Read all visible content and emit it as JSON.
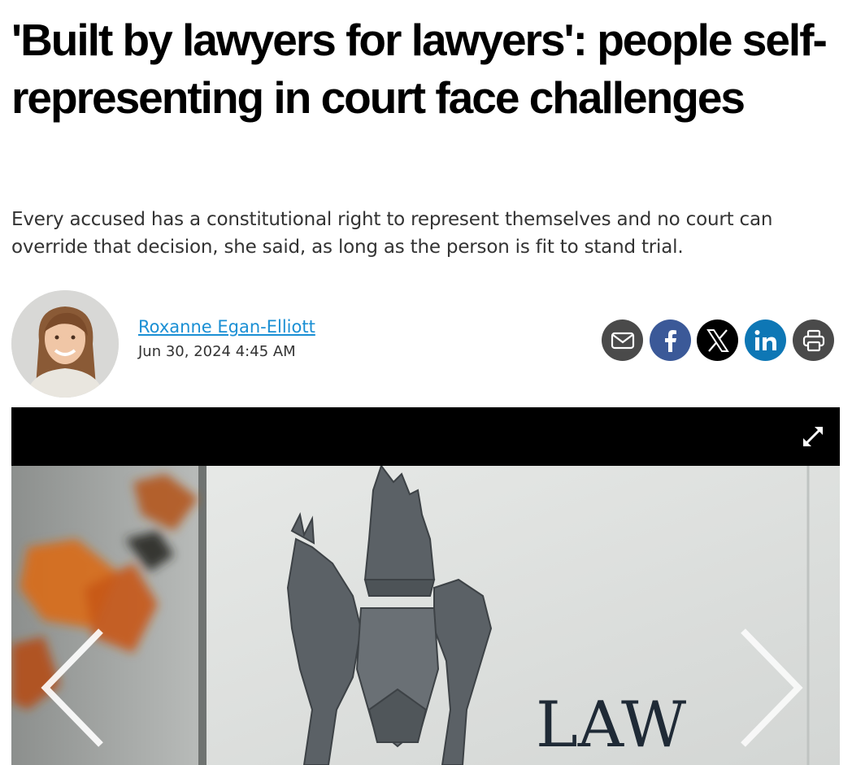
{
  "article": {
    "headline": "'Built by lawyers for lawyers': people self-representing in court face challenges",
    "deck": "Every accused has a constitutional right to represent themselves and no court can override that decision, she said, as long as the person is fit to stand trial."
  },
  "byline": {
    "author": "Roxanne Egan-Elliott",
    "date": "Jun 30, 2024 4:45 AM",
    "avatar_icon": "author-photo"
  },
  "share_buttons": [
    {
      "name": "email",
      "icon": "envelope-icon",
      "color": "#4a4a4a"
    },
    {
      "name": "facebook",
      "icon": "facebook-icon",
      "color": "#3b5998"
    },
    {
      "name": "x",
      "icon": "x-icon",
      "color": "#000000"
    },
    {
      "name": "linkedin",
      "icon": "linkedin-icon",
      "color": "#0e77b5"
    },
    {
      "name": "print",
      "icon": "printer-icon",
      "color": "#4a4a4a"
    }
  ],
  "gallery": {
    "photo_text": "LAW",
    "controls": [
      "expand-icon",
      "chevron-left-icon",
      "chevron-right-icon"
    ]
  }
}
